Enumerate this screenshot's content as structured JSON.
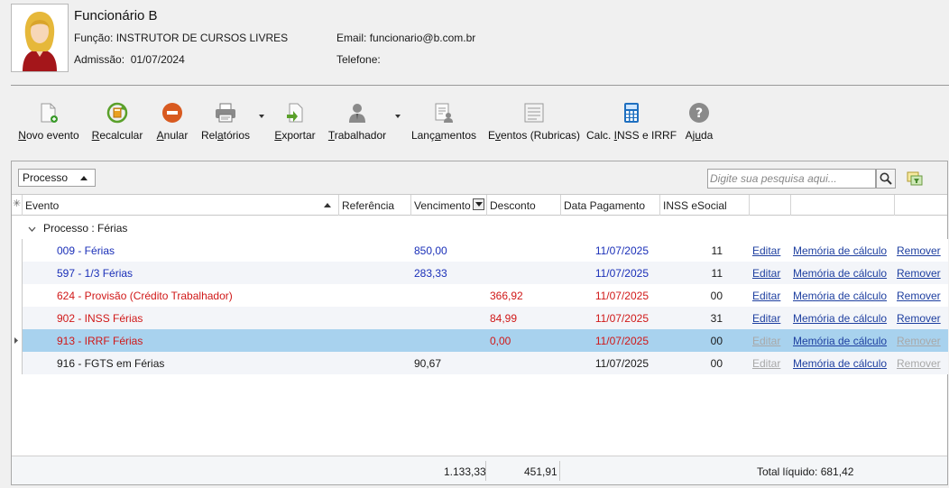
{
  "employee": {
    "name": "Funcionário B",
    "funcao_label": "Função:",
    "funcao": "INSTRUTOR DE CURSOS LIVRES",
    "admissao_label": "Admissão:",
    "admissao": "01/07/2024",
    "email_label": "Email:",
    "email": "funcionario@b.com.br",
    "telefone_label": "Telefone:",
    "telefone": ""
  },
  "toolbar": {
    "novo_evento": {
      "pre": "",
      "ul": "N",
      "post": "ovo evento"
    },
    "recalcular": {
      "pre": "",
      "ul": "R",
      "post": "ecalcular"
    },
    "anular": {
      "pre": "",
      "ul": "A",
      "post": "nular"
    },
    "relatorios": {
      "pre": "Rel",
      "ul": "a",
      "post": "tórios"
    },
    "exportar": {
      "pre": "",
      "ul": "E",
      "post": "xportar"
    },
    "trabalhador": {
      "pre": "",
      "ul": "T",
      "post": "rabalhador"
    },
    "lancamentos": {
      "pre": "Lanç",
      "ul": "a",
      "post": "mentos"
    },
    "eventos": {
      "pre": "E",
      "ul": "v",
      "post": "entos (Rubricas)"
    },
    "calc": {
      "pre": "Calc. ",
      "ul": "I",
      "post": "NSS e IRRF"
    },
    "ajuda": {
      "pre": "Aj",
      "ul": "u",
      "post": "da"
    }
  },
  "filter": {
    "combo_value": "Processo",
    "search_placeholder": "Digite sua pesquisa aqui..."
  },
  "columns": {
    "evento": "Evento",
    "referencia": "Referência",
    "vencimento": "Vencimento",
    "desconto": "Desconto",
    "data_pagamento": "Data Pagamento",
    "inss_esocial": "INSS eSocial"
  },
  "group": {
    "label": "Processo : Férias"
  },
  "colors": {
    "blue": "#1a2fb8",
    "red": "#d01818",
    "black": "#1a1a1a",
    "selected_row": "#a8d2ee",
    "alt_row": "#f3f5f9"
  },
  "rows": [
    {
      "evento": "009 - Férias",
      "vencimento": "850,00",
      "desconto": "",
      "data": "11/07/2025",
      "inss": "11",
      "editar": "Editar",
      "memoria": "Memória de cálculo",
      "remover": "Remover"
    },
    {
      "evento": "597 - 1/3 Férias",
      "vencimento": "283,33",
      "desconto": "",
      "data": "11/07/2025",
      "inss": "11",
      "editar": "Editar",
      "memoria": "Memória de cálculo",
      "remover": "Remover"
    },
    {
      "evento": "624 - Provisão (Crédito Trabalhador)",
      "vencimento": "",
      "desconto": "366,92",
      "data": "11/07/2025",
      "inss": "00",
      "editar": "Editar",
      "memoria": "Memória de cálculo",
      "remover": "Remover"
    },
    {
      "evento": "902 - INSS Férias",
      "vencimento": "",
      "desconto": "84,99",
      "data": "11/07/2025",
      "inss": "31",
      "editar": "Editar",
      "memoria": "Memória de cálculo",
      "remover": "Remover"
    },
    {
      "evento": "913 - IRRF Férias",
      "vencimento": "",
      "desconto": "0,00",
      "data": "11/07/2025",
      "inss": "00",
      "editar": "Editar",
      "memoria": "Memória de cálculo",
      "remover": "Remover"
    },
    {
      "evento": "916 - FGTS em Férias",
      "vencimento": "90,67",
      "desconto": "",
      "data": "11/07/2025",
      "inss": "00",
      "editar": "Editar",
      "memoria": "Memória de cálculo",
      "remover": "Remover"
    }
  ],
  "totals": {
    "vencimento": "1.133,33",
    "desconto": "451,91",
    "liquido": "Total líquido: 681,42"
  }
}
